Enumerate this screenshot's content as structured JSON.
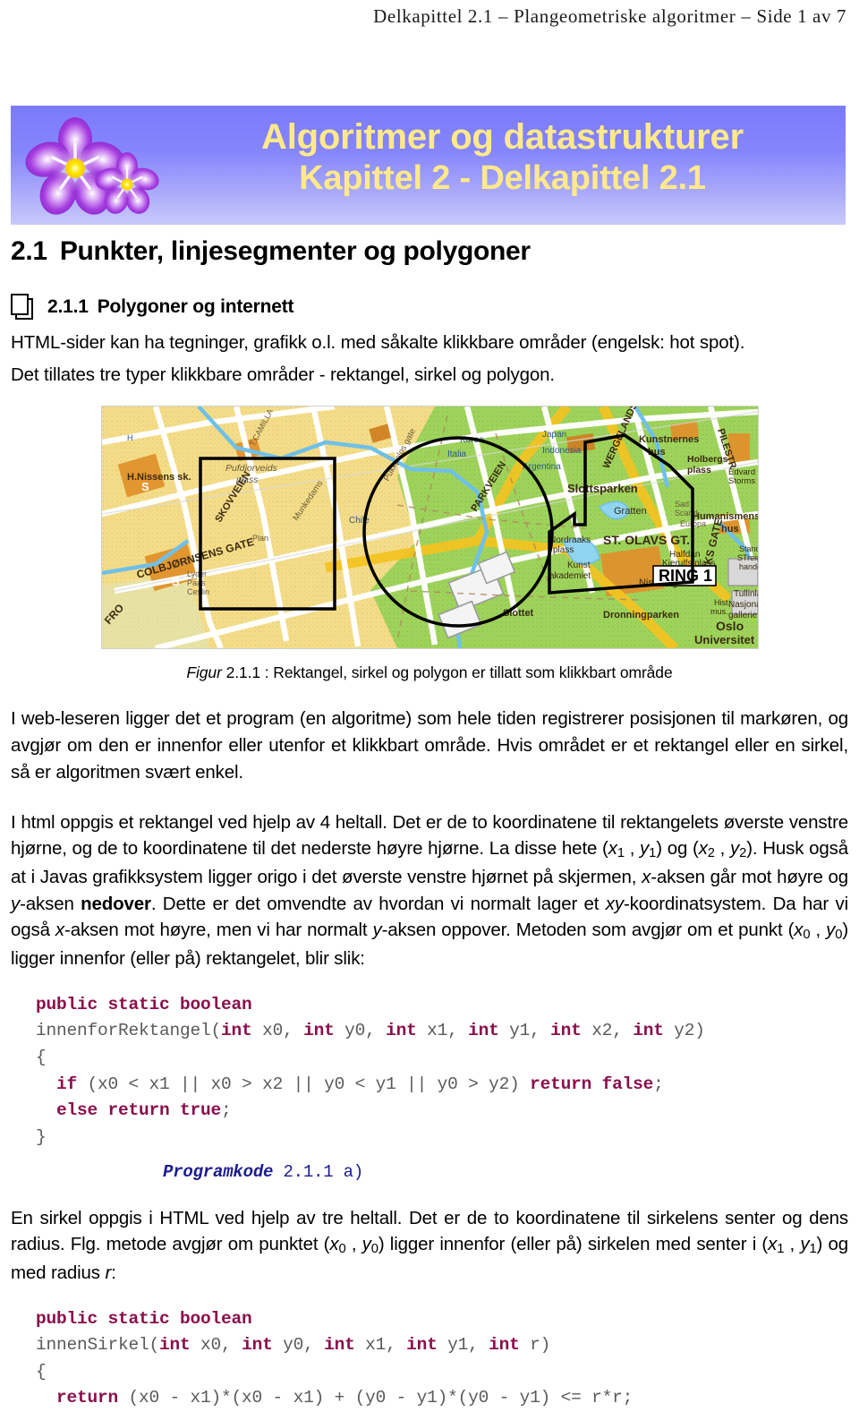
{
  "running_head": {
    "chapter": "Delkapittel 2.1",
    "sep1": "–",
    "subject": "Plangeometriske algoritmer",
    "sep2": "–",
    "page": "Side 1 av 7"
  },
  "banner": {
    "line1": "Algoritmer og datastrukturer",
    "line2": "Kapittel 2 - Delkapittel 2.1",
    "text_color": "#ffe98a",
    "gradient_top": "#7b7bfb",
    "gradient_bottom": "#c9c9fb",
    "flower_color": "#9b30d9",
    "flower_center_color": "#ffe800"
  },
  "section": {
    "number": "2.1",
    "title": "Punkter, linjesegmenter og polygoner"
  },
  "subsection": {
    "icon": "stacked-pages-icon",
    "number": "2.1.1",
    "title": "Polygoner og internett",
    "intro_line1": "HTML-sider kan ha tegninger, grafikk o.l. med såkalte klikkbare områder (engelsk: hot spot).",
    "intro_line2": "Det tillates tre typer klikkbare områder - rektangel, sirkel og polygon."
  },
  "figure": {
    "alt": "Kart over Oslo sentrum med rektangel, sirkel og polygon tegnet oppå",
    "caption_label": "Figur",
    "caption_number": "2.1.1",
    "caption_text": ": Rektangel, sirkel og polygon er tillatt som klikkbart område",
    "map_labels": [
      "H.Nissens sk.",
      "Pufdjorveids plass",
      "SKOVVEIEN",
      "COLBJØRNSENS GATE",
      "CAMILLA",
      "PARKVEIEN",
      "Slottsparken",
      "Kunstnernes hus",
      "WERGELANDSVEIEN",
      "Gratten",
      "Holbergs plass",
      "ST. OLAVS GT.",
      "RING 1",
      "Humanismens hus",
      "Dronningparken",
      "Slottet",
      "Nissberget",
      "Oslo Universitet",
      "Kunstakademiet",
      "PILESTR",
      "Korea",
      "Japan",
      "Italia",
      "Indonesia",
      "Argentina",
      "Chile",
      "Kjerulfs plass",
      "Hist. mus.",
      "Nasjonalgalleriet",
      "FRO",
      "Nordraaks plass"
    ]
  },
  "paragraphs": {
    "p1": "I web-leseren ligger det et program (en algoritme) som hele tiden registrerer posisjonen til markøren, og avgjør om den er innenfor eller utenfor et klikkbart område. Hvis området er et rektangel eller en sirkel, så er algoritmen svært enkel.",
    "p2_a": "I html oppgis et rektangel ved hjelp av 4 heltall. Det er de to koordinatene til rektangelets øverste venstre hjørne, og de to koordinatene til det nederste høyre hjørne. La disse hete (",
    "p2_x1": "x",
    "p2_x1_sub": "1",
    "p2_b": " , ",
    "p2_y1": "y",
    "p2_y1_sub": "1",
    "p2_c": ") og (",
    "p2_x2": "x",
    "p2_x2_sub": "2",
    "p2_y2": "y",
    "p2_y2_sub": "2",
    "p2_d": "). Husk også at i Javas grafikksystem ligger origo i det øverste venstre hjørnet på skjermen, ",
    "p2_xaxis": "x",
    "p2_e": "-aksen går mot høyre og ",
    "p2_yaxis": "y",
    "p2_f": "-aksen ",
    "p2_bold": "nedover",
    "p2_g": ". Dette er det omvendte av hvordan vi normalt lager et ",
    "p2_xy": "xy",
    "p2_h": "-koordinatsystem. Da har vi også ",
    "p2_i": "-aksen mot høyre, men vi har normalt ",
    "p2_j": "-aksen oppover. Metoden som avgjør om et punkt (",
    "p2_x0": "x",
    "p2_x0_sub": "0",
    "p2_y0": "y",
    "p2_y0_sub": "0",
    "p2_k": ") ligger innenfor (eller på) rektangelet, blir slik:",
    "p3_a": "En sirkel oppgis i HTML ved hjelp av tre heltall. Det er de to koordinatene til sirkelens senter og dens radius. Flg. metode avgjør om punktet (",
    "p3_b": ") ligger innenfor (eller på) sirkelen med senter i (",
    "p3_c": ") og med radius ",
    "p3_r": "r",
    "p3_d": ":"
  },
  "code_blocks": [
    {
      "name": "innenforRektangel",
      "lines": [
        [
          {
            "t": "public static boolean",
            "kw": true
          }
        ],
        [
          {
            "t": "innenforRektangel(",
            "kw": false
          },
          {
            "t": "int",
            "kw": true
          },
          {
            "t": " x0, ",
            "kw": false
          },
          {
            "t": "int",
            "kw": true
          },
          {
            "t": " y0, ",
            "kw": false
          },
          {
            "t": "int",
            "kw": true
          },
          {
            "t": " x1, ",
            "kw": false
          },
          {
            "t": "int",
            "kw": true
          },
          {
            "t": " y1, ",
            "kw": false
          },
          {
            "t": "int",
            "kw": true
          },
          {
            "t": " x2, ",
            "kw": false
          },
          {
            "t": "int",
            "kw": true
          },
          {
            "t": " y2)",
            "kw": false
          }
        ],
        [
          {
            "t": "{",
            "kw": false
          }
        ],
        [
          {
            "t": "  ",
            "kw": false
          },
          {
            "t": "if",
            "kw": true
          },
          {
            "t": " (x0 < x1 || x0 > x2 || y0 < y1 || y0 > y2) ",
            "kw": false
          },
          {
            "t": "return false",
            "kw": true
          },
          {
            "t": ";",
            "kw": false
          }
        ],
        [
          {
            "t": "  ",
            "kw": false
          },
          {
            "t": "else return true",
            "kw": true
          },
          {
            "t": ";",
            "kw": false
          }
        ],
        [
          {
            "t": "}",
            "kw": false
          }
        ]
      ],
      "caption_label": "Programkode",
      "caption_number": "2.1.1 a)"
    },
    {
      "name": "innenSirkel",
      "lines": [
        [
          {
            "t": "public static boolean",
            "kw": true
          }
        ],
        [
          {
            "t": "innenSirkel(",
            "kw": false
          },
          {
            "t": "int",
            "kw": true
          },
          {
            "t": " x0, ",
            "kw": false
          },
          {
            "t": "int",
            "kw": true
          },
          {
            "t": " y0, ",
            "kw": false
          },
          {
            "t": "int",
            "kw": true
          },
          {
            "t": " x1, ",
            "kw": false
          },
          {
            "t": "int",
            "kw": true
          },
          {
            "t": " y1, ",
            "kw": false
          },
          {
            "t": "int",
            "kw": true
          },
          {
            "t": " r)",
            "kw": false
          }
        ],
        [
          {
            "t": "{",
            "kw": false
          }
        ],
        [
          {
            "t": "  ",
            "kw": false
          },
          {
            "t": "return",
            "kw": true
          },
          {
            "t": " (x0 - x1)*(x0 - x1) + (y0 - y1)*(y0 - y1) <= r*r;",
            "kw": false
          }
        ]
      ],
      "caption_label": "",
      "caption_number": ""
    }
  ],
  "colors": {
    "code_keyword": "#8a0f4c",
    "code_plain": "#5a5a5a",
    "code_caption": "#1b1b8f"
  }
}
